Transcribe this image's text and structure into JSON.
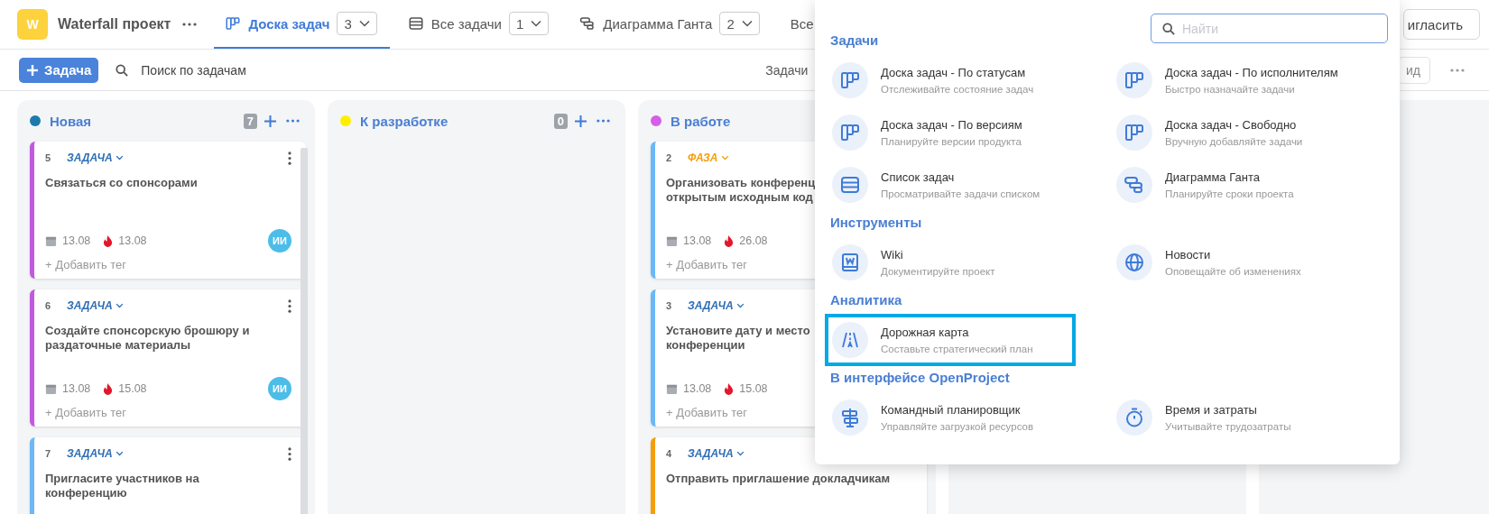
{
  "project": {
    "logo": "W",
    "name": "Waterfall проект"
  },
  "tabs": [
    {
      "label": "Доска задач",
      "count": "3",
      "selected": true
    },
    {
      "label": "Все задачи",
      "count": "1",
      "selected": false
    },
    {
      "label": "Диаграмма Ганта",
      "count": "2",
      "selected": false
    },
    {
      "label": "Все",
      "selected": false
    }
  ],
  "invite_button": "игласить",
  "toolbar": {
    "add_button": "Задача",
    "search_placeholder": "Поиск по задачам",
    "filter_label": "Задачи",
    "view_button": "ид"
  },
  "columns": [
    {
      "title": "Новая",
      "color": "#1c7bab",
      "count": "7",
      "cards": [
        {
          "number": "5",
          "type": {
            "label": "ЗАДАЧА",
            "color": "#2f6fb5"
          },
          "color": "#c159e0",
          "title": "Связаться со спонсорами",
          "start": "13.08",
          "due": "13.08",
          "assignee": "ИИ",
          "add_tag": "+ Добавить тег"
        },
        {
          "number": "6",
          "type": {
            "label": "ЗАДАЧА",
            "color": "#2f6fb5"
          },
          "color": "#c159e0",
          "title": "Создайте спонсорскую брошюру и раздаточные материалы",
          "start": "13.08",
          "due": "15.08",
          "assignee": "ИИ",
          "add_tag": "+ Добавить тег"
        },
        {
          "number": "7",
          "type": {
            "label": "ЗАДАЧА",
            "color": "#2f6fb5"
          },
          "color": "#6ab8f7",
          "title": "Пригласите участников на конференцию"
        }
      ]
    },
    {
      "title": "К разработке",
      "color": "#ffee00",
      "count": "0"
    },
    {
      "title": "В работе",
      "color": "#d55ee8",
      "cards": [
        {
          "number": "2",
          "type": {
            "label": "ФАЗА",
            "color": "#f59e0b"
          },
          "color": "#6ab8f7",
          "title": "Организовать конференц\nоткрытым исходным код",
          "start": "13.08",
          "due": "26.08",
          "add_tag": "+ Добавить тег"
        },
        {
          "number": "3",
          "type": {
            "label": "ЗАДАЧА",
            "color": "#2f6fb5"
          },
          "color": "#6ab8f7",
          "title": "Установите дату и место\nконференции",
          "start": "13.08",
          "due": "15.08",
          "add_tag": "+ Добавить тег"
        },
        {
          "number": "4",
          "type": {
            "label": "ЗАДАЧА",
            "color": "#2f6fb5"
          },
          "color": "#f59e0b",
          "title": "Отправить приглашение докладчикам"
        }
      ]
    }
  ],
  "menu": {
    "search": {
      "placeholder": "Найти"
    },
    "sections": [
      {
        "title": "Задачи",
        "items": [
          {
            "title": "Доска задач - По статусам",
            "description": "Отслеживайте состояние задач",
            "selected": false
          },
          {
            "title": "Доска задач - По исполнителям",
            "description": "Быстро назначайте задачи",
            "selected": false
          },
          {
            "title": "Доска задач - По версиям",
            "description": "Планируйте версии продукта",
            "selected": false
          },
          {
            "title": "Доска задач - Свободно",
            "description": "Вручную добавляйте задачи",
            "selected": false
          },
          {
            "title": "Список задач",
            "description": "Просматривайте задачи списком",
            "selected": false
          },
          {
            "title": "Диаграмма Ганта",
            "description": "Планируйте сроки проекта",
            "selected": false
          }
        ]
      },
      {
        "title": "Инструменты",
        "items": [
          {
            "title": "Wiki",
            "description": "Документируйте проект",
            "selected": false
          },
          {
            "title": "Новости",
            "description": "Оповещайте об изменениях",
            "selected": false
          }
        ]
      },
      {
        "title": "Аналитика",
        "items": [
          {
            "title": "Дорожная карта",
            "description": "Составьте стратегический план",
            "selected": true
          }
        ]
      },
      {
        "title": "В интерфейсе OpenProject",
        "items": [
          {
            "title": "Командный планировщик",
            "description": "Управляйте загрузкой ресурсов",
            "selected": false
          },
          {
            "title": "Время и затраты",
            "description": "Учитывайте трудозатраты",
            "selected": false
          }
        ]
      }
    ]
  }
}
